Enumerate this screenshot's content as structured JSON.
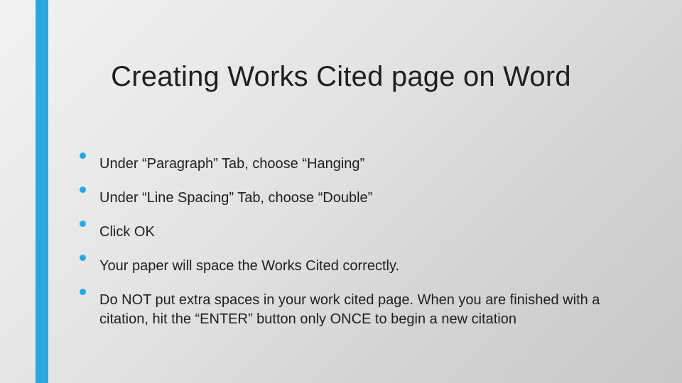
{
  "slide": {
    "title": "Creating Works Cited page on Word",
    "bullets": [
      "Under “Paragraph” Tab, choose “Hanging”",
      "Under “Line Spacing” Tab, choose “Double”",
      "Click OK",
      "Your paper will space the Works Cited correctly.",
      "Do NOT put extra spaces in your work cited page. When you are finished with a citation, hit the “ENTER” button only ONCE to begin a new citation"
    ]
  }
}
